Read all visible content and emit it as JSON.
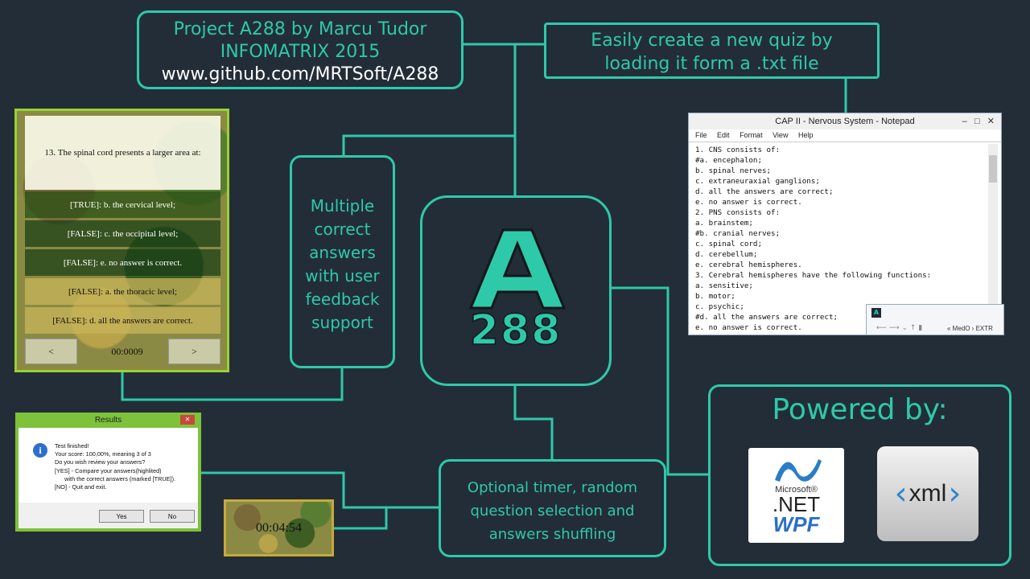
{
  "project_box": {
    "line1": "Project A288 by Marcu Tudor",
    "line2": "INFOMATRIX 2015",
    "line3": "www.github.com/MRTSoft/A288"
  },
  "quiz_box": {
    "line1": "Easily create a new quiz by",
    "line2": "loading it form a .txt file"
  },
  "multi_box": {
    "lines": [
      "Multiple",
      "correct",
      "answers",
      "with user",
      "feedback",
      "support"
    ]
  },
  "logo": {
    "letter": "A",
    "number": "288"
  },
  "timer_box": {
    "line1": "Optional timer, random",
    "line2": "question selection and",
    "line3": "answers shuffling"
  },
  "powered": {
    "title": "Powered by:"
  },
  "quiz_app": {
    "question": "13. The spinal cord presents a larger area at:",
    "answers": [
      "[TRUE]: b. the cervical level;",
      "[FALSE]: c. the occipital level;",
      "[FALSE]: e. no answer is correct.",
      "[FALSE]: a. the thoracic level;",
      "[FALSE]: d. all the answers are correct."
    ],
    "prev_label": "<",
    "next_label": ">",
    "timer": "00:0009"
  },
  "notepad": {
    "title": "CAP II - Nervous System - Notepad",
    "menu": [
      "File",
      "Edit",
      "Format",
      "View",
      "Help"
    ],
    "lines": [
      "1. CNS consists of:",
      "#a. encephalon;",
      "b. spinal nerves;",
      "c. extraneuraxial ganglions;",
      "d. all the answers are correct;",
      "e. no answer is correct.",
      "2. PNS consists of:",
      "a. brainstem;",
      "#b. cranial nerves;",
      "c. spinal cord;",
      "d. cerebellum;",
      "e. cerebral hemispheres.",
      "3. Cerebral hemispheres have the following functions:",
      "a. sensitive;",
      "b. motor;",
      "c. psychic;",
      "#d. all the answers are correct;",
      "e. no answer is correct."
    ],
    "explorer_path": "« MedO › EXTR"
  },
  "results": {
    "title": "Results",
    "close": "✕",
    "lines": [
      "Test finished!",
      "Your score: 100,00%, meaning 3 of 3",
      "Do you wish review your answers?",
      "[YES] - Compare your answers(highlited)",
      "      with the correct answers (marked [TRUE]).",
      "[NO] - Quit and exit."
    ],
    "yes": "Yes",
    "no": "No"
  },
  "timer_display": "00:04:54",
  "net_logo": {
    "microsoft": "Microsoft®",
    "net": ".NET",
    "wpf": "WPF"
  },
  "xml_logo": {
    "text": "xml"
  },
  "colors": {
    "background": "#232d38",
    "accent": "#2ec9a8"
  }
}
